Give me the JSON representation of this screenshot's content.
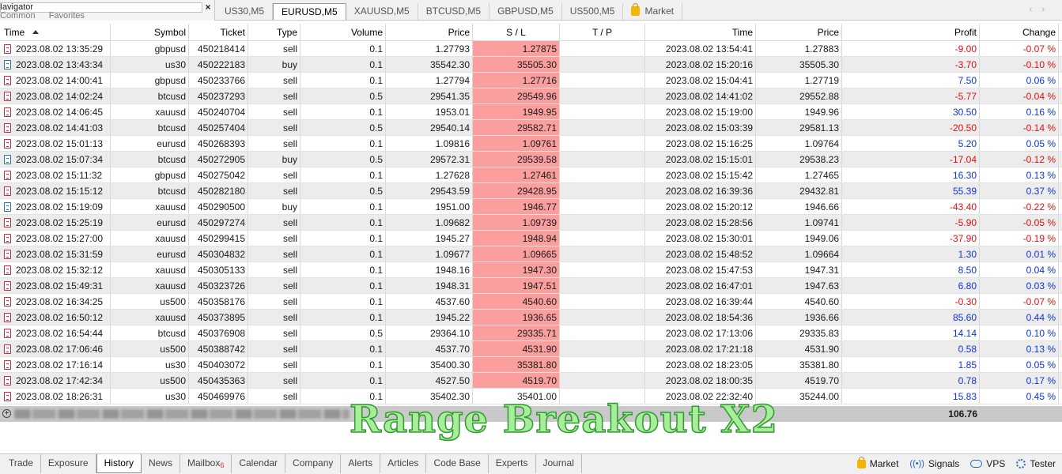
{
  "navigator": {
    "title": "Navigator",
    "tabs": [
      "Common",
      "Favorites"
    ],
    "close": "×"
  },
  "chart_tabs": [
    {
      "label": "US30,M5",
      "active": false
    },
    {
      "label": "EURUSD,M5",
      "active": true
    },
    {
      "label": "XAUUSD,M5",
      "active": false
    },
    {
      "label": "BTCUSD,M5",
      "active": false
    },
    {
      "label": "GBPUSD,M5",
      "active": false
    },
    {
      "label": "US500,M5",
      "active": false
    },
    {
      "label": "Market",
      "active": false,
      "icon": "market-bag-icon"
    }
  ],
  "tab_scroll": {
    "left": "‹",
    "right": "›"
  },
  "columns": {
    "time": "Time",
    "symbol": "Symbol",
    "ticket": "Ticket",
    "type": "Type",
    "volume": "Volume",
    "price": "Price",
    "sl": "S / L",
    "tp": "T / P",
    "close_time": "Time",
    "close_price": "Price",
    "profit": "Profit",
    "change": "Change"
  },
  "rows": [
    {
      "time": "2023.08.02 13:35:29",
      "symbol": "gbpusd",
      "ticket": "450218414",
      "type": "sell",
      "volume": "0.1",
      "price": "1.27793",
      "sl": "1.27875",
      "tp": "",
      "close_time": "2023.08.02 13:54:41",
      "close_price": "1.27883",
      "profit": "-9.00",
      "change": "-0.07 %"
    },
    {
      "time": "2023.08.02 13:43:34",
      "symbol": "us30",
      "ticket": "450222183",
      "type": "buy",
      "volume": "0.1",
      "price": "35542.30",
      "sl": "35505.30",
      "tp": "",
      "close_time": "2023.08.02 15:20:16",
      "close_price": "35505.30",
      "profit": "-3.70",
      "change": "-0.10 %"
    },
    {
      "time": "2023.08.02 14:00:41",
      "symbol": "gbpusd",
      "ticket": "450233766",
      "type": "sell",
      "volume": "0.1",
      "price": "1.27794",
      "sl": "1.27716",
      "tp": "",
      "close_time": "2023.08.02 15:04:41",
      "close_price": "1.27719",
      "profit": "7.50",
      "change": "0.06 %"
    },
    {
      "time": "2023.08.02 14:02:24",
      "symbol": "btcusd",
      "ticket": "450237293",
      "type": "sell",
      "volume": "0.5",
      "price": "29541.35",
      "sl": "29549.96",
      "tp": "",
      "close_time": "2023.08.02 14:41:02",
      "close_price": "29552.88",
      "profit": "-5.77",
      "change": "-0.04 %"
    },
    {
      "time": "2023.08.02 14:06:45",
      "symbol": "xauusd",
      "ticket": "450240704",
      "type": "sell",
      "volume": "0.1",
      "price": "1953.01",
      "sl": "1949.95",
      "tp": "",
      "close_time": "2023.08.02 15:19:00",
      "close_price": "1949.96",
      "profit": "30.50",
      "change": "0.16 %"
    },
    {
      "time": "2023.08.02 14:41:03",
      "symbol": "btcusd",
      "ticket": "450257404",
      "type": "sell",
      "volume": "0.5",
      "price": "29540.14",
      "sl": "29582.71",
      "tp": "",
      "close_time": "2023.08.02 15:03:39",
      "close_price": "29581.13",
      "profit": "-20.50",
      "change": "-0.14 %"
    },
    {
      "time": "2023.08.02 15:01:13",
      "symbol": "eurusd",
      "ticket": "450268393",
      "type": "sell",
      "volume": "0.1",
      "price": "1.09816",
      "sl": "1.09761",
      "tp": "",
      "close_time": "2023.08.02 15:16:25",
      "close_price": "1.09764",
      "profit": "5.20",
      "change": "0.05 %"
    },
    {
      "time": "2023.08.02 15:07:34",
      "symbol": "btcusd",
      "ticket": "450272905",
      "type": "buy",
      "volume": "0.5",
      "price": "29572.31",
      "sl": "29539.58",
      "tp": "",
      "close_time": "2023.08.02 15:15:01",
      "close_price": "29538.23",
      "profit": "-17.04",
      "change": "-0.12 %"
    },
    {
      "time": "2023.08.02 15:11:32",
      "symbol": "gbpusd",
      "ticket": "450275042",
      "type": "sell",
      "volume": "0.1",
      "price": "1.27628",
      "sl": "1.27461",
      "tp": "",
      "close_time": "2023.08.02 15:15:42",
      "close_price": "1.27465",
      "profit": "16.30",
      "change": "0.13 %"
    },
    {
      "time": "2023.08.02 15:15:12",
      "symbol": "btcusd",
      "ticket": "450282180",
      "type": "sell",
      "volume": "0.5",
      "price": "29543.59",
      "sl": "29428.95",
      "tp": "",
      "close_time": "2023.08.02 16:39:36",
      "close_price": "29432.81",
      "profit": "55.39",
      "change": "0.37 %"
    },
    {
      "time": "2023.08.02 15:19:09",
      "symbol": "xauusd",
      "ticket": "450290500",
      "type": "buy",
      "volume": "0.1",
      "price": "1951.00",
      "sl": "1946.77",
      "tp": "",
      "close_time": "2023.08.02 15:20:12",
      "close_price": "1946.66",
      "profit": "-43.40",
      "change": "-0.22 %"
    },
    {
      "time": "2023.08.02 15:25:19",
      "symbol": "eurusd",
      "ticket": "450297274",
      "type": "sell",
      "volume": "0.1",
      "price": "1.09682",
      "sl": "1.09739",
      "tp": "",
      "close_time": "2023.08.02 15:28:56",
      "close_price": "1.09741",
      "profit": "-5.90",
      "change": "-0.05 %"
    },
    {
      "time": "2023.08.02 15:27:00",
      "symbol": "xauusd",
      "ticket": "450299415",
      "type": "sell",
      "volume": "0.1",
      "price": "1945.27",
      "sl": "1948.94",
      "tp": "",
      "close_time": "2023.08.02 15:30:01",
      "close_price": "1949.06",
      "profit": "-37.90",
      "change": "-0.19 %"
    },
    {
      "time": "2023.08.02 15:31:59",
      "symbol": "eurusd",
      "ticket": "450304832",
      "type": "sell",
      "volume": "0.1",
      "price": "1.09677",
      "sl": "1.09665",
      "tp": "",
      "close_time": "2023.08.02 15:48:52",
      "close_price": "1.09664",
      "profit": "1.30",
      "change": "0.01 %"
    },
    {
      "time": "2023.08.02 15:32:12",
      "symbol": "xauusd",
      "ticket": "450305133",
      "type": "sell",
      "volume": "0.1",
      "price": "1948.16",
      "sl": "1947.30",
      "tp": "",
      "close_time": "2023.08.02 15:47:53",
      "close_price": "1947.31",
      "profit": "8.50",
      "change": "0.04 %"
    },
    {
      "time": "2023.08.02 15:49:31",
      "symbol": "xauusd",
      "ticket": "450323726",
      "type": "sell",
      "volume": "0.1",
      "price": "1948.31",
      "sl": "1947.51",
      "tp": "",
      "close_time": "2023.08.02 16:47:01",
      "close_price": "1947.63",
      "profit": "6.80",
      "change": "0.03 %"
    },
    {
      "time": "2023.08.02 16:34:25",
      "symbol": "us500",
      "ticket": "450358176",
      "type": "sell",
      "volume": "0.1",
      "price": "4537.60",
      "sl": "4540.60",
      "tp": "",
      "close_time": "2023.08.02 16:39:44",
      "close_price": "4540.60",
      "profit": "-0.30",
      "change": "-0.07 %"
    },
    {
      "time": "2023.08.02 16:50:12",
      "symbol": "xauusd",
      "ticket": "450373895",
      "type": "sell",
      "volume": "0.1",
      "price": "1945.22",
      "sl": "1936.65",
      "tp": "",
      "close_time": "2023.08.02 18:54:36",
      "close_price": "1936.66",
      "profit": "85.60",
      "change": "0.44 %"
    },
    {
      "time": "2023.08.02 16:54:44",
      "symbol": "btcusd",
      "ticket": "450376908",
      "type": "sell",
      "volume": "0.5",
      "price": "29364.10",
      "sl": "29335.71",
      "tp": "",
      "close_time": "2023.08.02 17:13:06",
      "close_price": "29335.83",
      "profit": "14.14",
      "change": "0.10 %"
    },
    {
      "time": "2023.08.02 17:06:46",
      "symbol": "us500",
      "ticket": "450388742",
      "type": "sell",
      "volume": "0.1",
      "price": "4537.70",
      "sl": "4531.90",
      "tp": "",
      "close_time": "2023.08.02 17:21:18",
      "close_price": "4531.90",
      "profit": "0.58",
      "change": "0.13 %"
    },
    {
      "time": "2023.08.02 17:16:14",
      "symbol": "us30",
      "ticket": "450403072",
      "type": "sell",
      "volume": "0.1",
      "price": "35400.30",
      "sl": "35381.80",
      "tp": "",
      "close_time": "2023.08.02 18:23:05",
      "close_price": "35381.80",
      "profit": "1.85",
      "change": "0.05 %"
    },
    {
      "time": "2023.08.02 17:42:34",
      "symbol": "us500",
      "ticket": "450435363",
      "type": "sell",
      "volume": "0.1",
      "price": "4527.50",
      "sl": "4519.70",
      "tp": "",
      "close_time": "2023.08.02 18:00:35",
      "close_price": "4519.70",
      "profit": "0.78",
      "change": "0.17 %"
    },
    {
      "time": "2023.08.02 18:26:31",
      "symbol": "us30",
      "ticket": "450469976",
      "type": "sell",
      "volume": "0.1",
      "price": "35402.30",
      "sl": "35401.00",
      "tp": "",
      "close_time": "2023.08.02 22:32:40",
      "close_price": "35244.00",
      "profit": "15.83",
      "change": "0.45 %"
    }
  ],
  "total": {
    "profit": "106.76"
  },
  "watermark": "Range Breakout X2",
  "bottom_tabs": [
    {
      "label": "Trade",
      "active": false
    },
    {
      "label": "Exposure",
      "active": false
    },
    {
      "label": "History",
      "active": true
    },
    {
      "label": "News",
      "active": false
    },
    {
      "label": "Mailbox",
      "badge": "6",
      "active": false
    },
    {
      "label": "Calendar",
      "active": false
    },
    {
      "label": "Company",
      "active": false
    },
    {
      "label": "Alerts",
      "active": false
    },
    {
      "label": "Articles",
      "active": false
    },
    {
      "label": "Code Base",
      "active": false
    },
    {
      "label": "Experts",
      "active": false
    },
    {
      "label": "Journal",
      "active": false
    }
  ],
  "bottom_right": [
    {
      "label": "Market",
      "icon": "market-bag-icon"
    },
    {
      "label": "Signals",
      "icon": "signals-icon"
    },
    {
      "label": "VPS",
      "icon": "vps-cloud-icon"
    },
    {
      "label": "Tester",
      "icon": "tester-icon"
    }
  ],
  "colors": {
    "sl_highlight": "#fb9e9e",
    "loss": "#e01010",
    "profit": "#1034d8",
    "watermark": "#a8ee9a"
  }
}
